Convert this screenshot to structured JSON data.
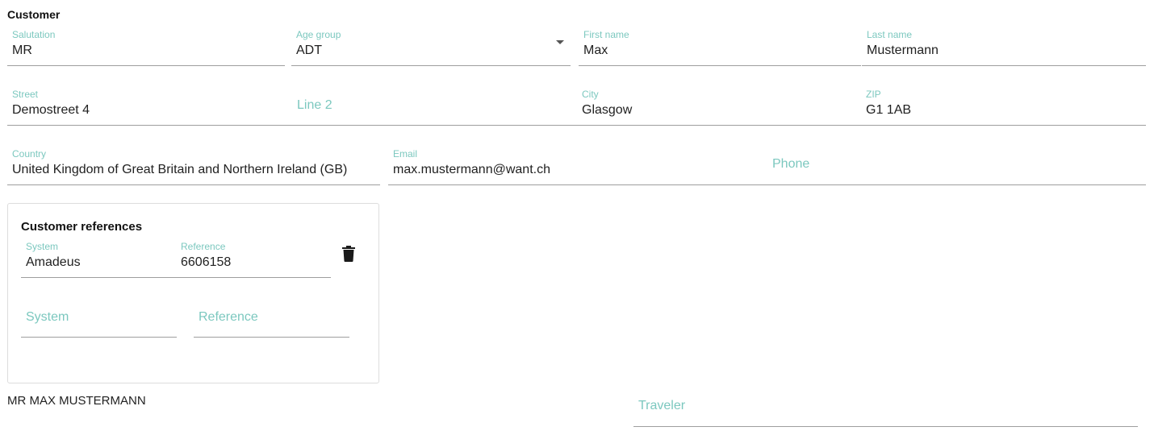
{
  "customer": {
    "title": "Customer",
    "salutation": {
      "label": "Salutation",
      "value": "MR"
    },
    "age_group": {
      "label": "Age group",
      "value": "ADT"
    },
    "first_name": {
      "label": "First name",
      "value": "Max"
    },
    "last_name": {
      "label": "Last name",
      "value": "Mustermann"
    },
    "street": {
      "label": "Street",
      "value": "Demostreet 4"
    },
    "line2": {
      "placeholder": "Line 2"
    },
    "city": {
      "label": "City",
      "value": "Glasgow"
    },
    "zip": {
      "label": "ZIP",
      "value": "G1 1AB"
    },
    "country": {
      "label": "Country",
      "value": "United Kingdom of Great Britain and Northern Ireland (GB)"
    },
    "email": {
      "label": "Email",
      "value": "max.mustermann@want.ch"
    },
    "phone": {
      "placeholder": "Phone"
    }
  },
  "customer_references": {
    "title": "Customer references",
    "rows": [
      {
        "system_label": "System",
        "system_value": "Amadeus",
        "reference_label": "Reference",
        "reference_value": "6606158",
        "delete_icon": "trash-icon"
      }
    ],
    "new_row": {
      "system_placeholder": "System",
      "reference_placeholder": "Reference"
    }
  },
  "summary": {
    "name": "MR MAX MUSTERMANN"
  },
  "traveler": {
    "placeholder": "Traveler"
  },
  "colors": {
    "label": "#7cc8bf",
    "underline": "#9e9e9e",
    "text": "#212121"
  }
}
